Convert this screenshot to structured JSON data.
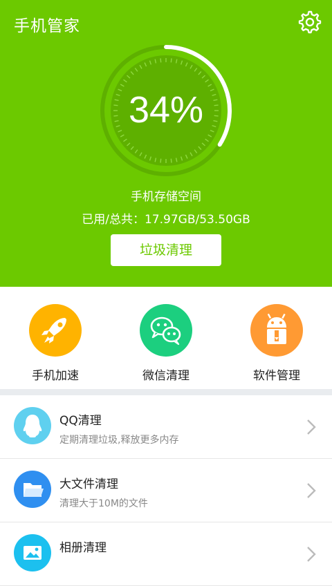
{
  "app": {
    "title": "手机管家"
  },
  "storage": {
    "percent_label": "34%",
    "percent_value": 0.34,
    "label": "手机存储空间",
    "usage": "已用/总共：17.97GB/53.50GB"
  },
  "clean_button": {
    "label": "垃圾清理"
  },
  "tools": [
    {
      "label": "手机加速",
      "icon": "rocket-icon",
      "color": "#ffb300"
    },
    {
      "label": "微信清理",
      "icon": "wechat-icon",
      "color": "#1ccf7f"
    },
    {
      "label": "软件管理",
      "icon": "android-icon",
      "color": "#ff9a33"
    }
  ],
  "list": [
    {
      "title": "QQ清理",
      "subtitle": "定期清理垃圾,释放更多内存",
      "icon": "qq-penguin-icon",
      "color": "#5fd0ef"
    },
    {
      "title": "大文件清理",
      "subtitle": "清理大于10M的文件",
      "icon": "folder-icon",
      "color": "#2f8ff0"
    },
    {
      "title": "相册清理",
      "subtitle": "",
      "icon": "image-icon",
      "color": "#1cc0ef"
    }
  ],
  "colors": {
    "brand_green": "#6cc900",
    "divider": "#e9ecef"
  }
}
